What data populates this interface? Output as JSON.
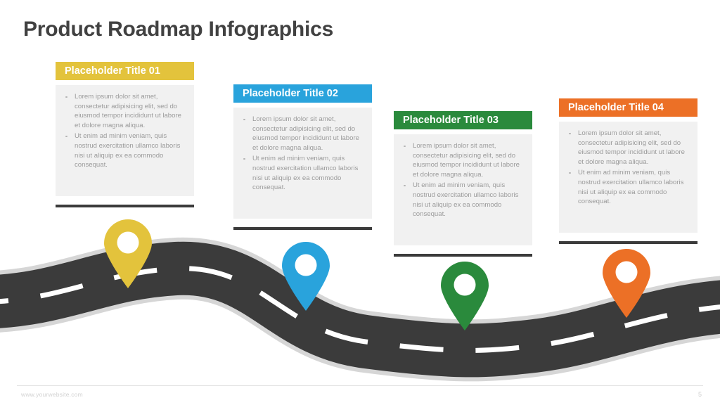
{
  "slide": {
    "title": "Product Roadmap Infographics",
    "background_color": "#FFFFFF",
    "title_color": "#414141"
  },
  "road": {
    "asphalt_color": "#3B3B3B",
    "shoulder_color": "#D6D6D6",
    "lane_marking_color": "#FFFFFF"
  },
  "cards": [
    {
      "id": "card-01",
      "title": "Placeholder Title 01",
      "accent_color": "#E3C33C",
      "underline_color": "#3B3B3B",
      "body_color": "#F1F1F1",
      "bullets": [
        "Lorem ipsum dolor sit amet, consectetur adipisicing elit, sed do eiusmod tempor incididunt ut labore et dolore magna aliqua.",
        "Ut enim ad minim veniam, quis nostrud exercitation ullamco laboris nisi ut aliquip ex ea commodo consequat."
      ]
    },
    {
      "id": "card-02",
      "title": "Placeholder Title 02",
      "accent_color": "#29A3DC",
      "underline_color": "#3B3B3B",
      "body_color": "#F1F1F1",
      "bullets": [
        "Lorem ipsum dolor sit amet, consectetur adipisicing elit, sed do eiusmod tempor incididunt ut labore et dolore magna aliqua.",
        "Ut enim ad minim veniam, quis nostrud exercitation ullamco laboris nisi ut aliquip ex ea commodo consequat."
      ]
    },
    {
      "id": "card-03",
      "title": "Placeholder Title 03",
      "accent_color": "#2A8A3C",
      "underline_color": "#3B3B3B",
      "body_color": "#F1F1F1",
      "bullets": [
        "Lorem ipsum dolor sit amet, consectetur adipisicing elit, sed do eiusmod tempor incididunt ut labore et dolore magna aliqua.",
        "Ut enim ad minim veniam, quis nostrud exercitation ullamco laboris nisi ut aliquip ex ea commodo consequat."
      ]
    },
    {
      "id": "card-04",
      "title": "Placeholder Title 04",
      "accent_color": "#EC7026",
      "underline_color": "#3B3B3B",
      "body_color": "#F1F1F1",
      "bullets": [
        "Lorem ipsum dolor sit amet, consectetur adipisicing elit, sed do eiusmod tempor incididunt ut labore et dolore magna aliqua.",
        "Ut enim ad minim veniam, quis nostrud exercitation ullamco laboris nisi ut aliquip ex ea commodo consequat."
      ]
    }
  ],
  "pins": [
    {
      "id": "pin-01",
      "color": "#E3C33C",
      "linked_card": "Placeholder Title 01"
    },
    {
      "id": "pin-02",
      "color": "#29A3DC",
      "linked_card": "Placeholder Title 02"
    },
    {
      "id": "pin-03",
      "color": "#2A8A3C",
      "linked_card": "Placeholder Title 03"
    },
    {
      "id": "pin-04",
      "color": "#EC7026",
      "linked_card": "Placeholder Title 04"
    }
  ],
  "footer": {
    "website": "www.yourwebsite.com",
    "page_number": "5"
  }
}
